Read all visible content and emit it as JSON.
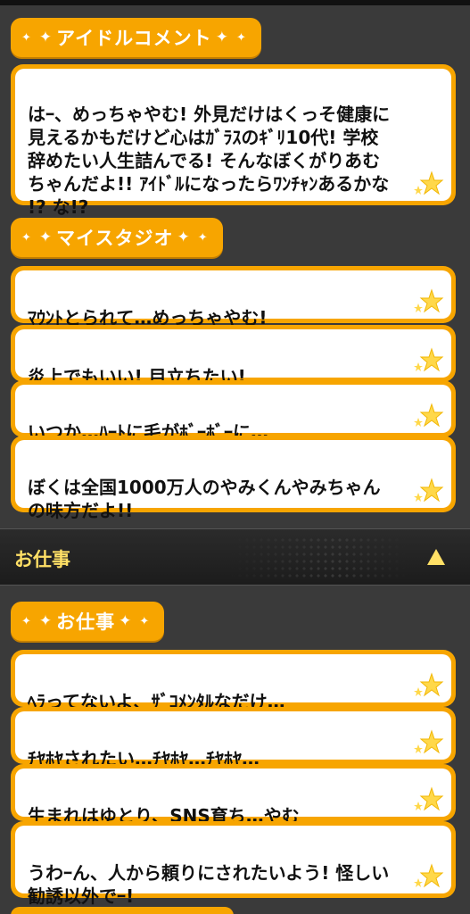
{
  "idol_comment": {
    "tab_label": "アイドルコメント",
    "text": "はｰ、めっちゃやむ! 外見だけはくっそ健康に\n見えるかもだけど心はｶﾞﾗｽのｷﾞﾘ10代! 学校\n辞めたい人生詰んでる! そんなぼくがりあむ\nちゃんだよ!! ｱｲﾄﾞﾙになったらﾜﾝﾁｬﾝあるかな\n!? な!?"
  },
  "my_studio": {
    "tab_label": "マイスタジオ",
    "lines": [
      "ﾏｳﾝﾄとられて…めっちゃやむ!",
      "炎上でもいい! 目立ちたい!",
      "いつか…ﾊｰﾄに毛がﾎﾞｰﾎﾞｰに…",
      "ぼくは全国1000万人のやみくんやみちゃん\nの味方だよ!!"
    ]
  },
  "work_section": {
    "header_title": "お仕事",
    "tab_label": "お仕事",
    "lines": [
      "ﾍﾗってないよ、ｻﾞｺﾒﾝﾀﾙなだけ…",
      "ﾁﾔﾎﾔされたい…ﾁﾔﾎﾔ…ﾁﾔﾎﾔ…",
      "生まれはゆとり、SNS育ち…やむ",
      "うわｰん、人から頼りにされたいよう! 怪しい\n勧誘以外でｰ!"
    ]
  },
  "colors": {
    "accent": "#f7a500",
    "star": "#ffd84a",
    "header_text": "#ffe066",
    "background": "#3c3c3c"
  },
  "icons": {
    "sparkle": "sparkle-icon",
    "stars": "stars-icon",
    "toggle": "triangle-up-icon"
  }
}
